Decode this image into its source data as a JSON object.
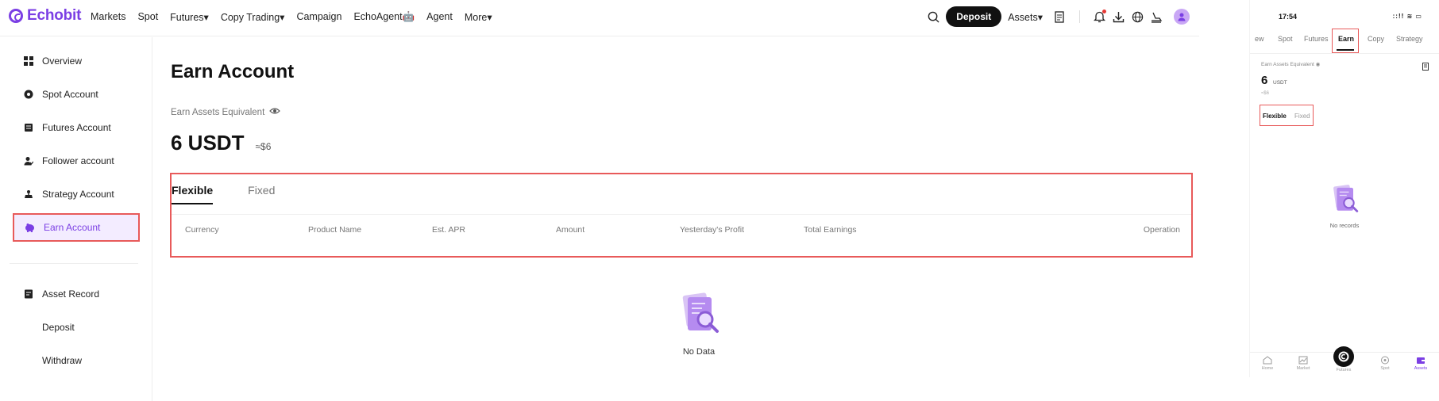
{
  "brand": {
    "name": "Echobit",
    "accent": "#7b3fe4"
  },
  "topnav": {
    "links": [
      "Markets",
      "Spot",
      "Futures▾",
      "Copy Trading▾",
      "Campaign",
      "EchoAgent🤖",
      "Agent",
      "More▾"
    ],
    "deposit_label": "Deposit",
    "assets_label": "Assets▾",
    "icons": [
      "search-icon",
      "record-icon",
      "bell-icon",
      "download-icon",
      "globe-icon",
      "theme-icon",
      "avatar-icon"
    ]
  },
  "sidebar": {
    "items": [
      {
        "label": "Overview",
        "icon": "grid-icon"
      },
      {
        "label": "Spot Account",
        "icon": "spot-icon"
      },
      {
        "label": "Futures Account",
        "icon": "futures-icon"
      },
      {
        "label": "Follower account",
        "icon": "follower-icon"
      },
      {
        "label": "Strategy Account",
        "icon": "strategy-icon"
      },
      {
        "label": "Earn Account",
        "icon": "piggy-icon",
        "active": true
      },
      {
        "label": "Asset Record",
        "icon": "record-icon"
      },
      {
        "label": "Deposit",
        "icon": ""
      },
      {
        "label": "Withdraw",
        "icon": ""
      }
    ]
  },
  "main": {
    "title": "Earn Account",
    "equivalent_label": "Earn Assets Equivalent",
    "equivalent_value": "6 USDT",
    "equivalent_usd": "≈$6",
    "tabs": [
      {
        "label": "Flexible",
        "active": true
      },
      {
        "label": "Fixed",
        "active": false
      }
    ],
    "columns": [
      "Currency",
      "Product Name",
      "Est. APR",
      "Amount",
      "Yesterday's Profit",
      "Total Earnings",
      "Operation"
    ],
    "empty_text": "No Data"
  },
  "mobile": {
    "time": "17:54",
    "status_icons": "::!! ≋ ▭",
    "tabs": [
      {
        "label": "ew",
        "active": false
      },
      {
        "label": "Spot",
        "active": false
      },
      {
        "label": "Futures",
        "active": false
      },
      {
        "label": "Earn",
        "active": true
      },
      {
        "label": "Copy",
        "active": false
      },
      {
        "label": "Strategy",
        "active": false
      }
    ],
    "equivalent_label": "Earn Assets Equivalent",
    "equivalent_value": "6",
    "equivalent_unit": "USDT",
    "equivalent_approx": "≈$6",
    "sub_tabs": [
      "Flexible",
      "Fixed"
    ],
    "empty_text": "No records",
    "bottom_nav": [
      {
        "label": "Home",
        "icon": "home-icon"
      },
      {
        "label": "Market",
        "icon": "market-icon"
      },
      {
        "label": "Futures",
        "icon": "futures-logo-icon"
      },
      {
        "label": "Spot",
        "icon": "spot-icon"
      },
      {
        "label": "Assets",
        "icon": "wallet-icon",
        "active": true
      }
    ]
  }
}
